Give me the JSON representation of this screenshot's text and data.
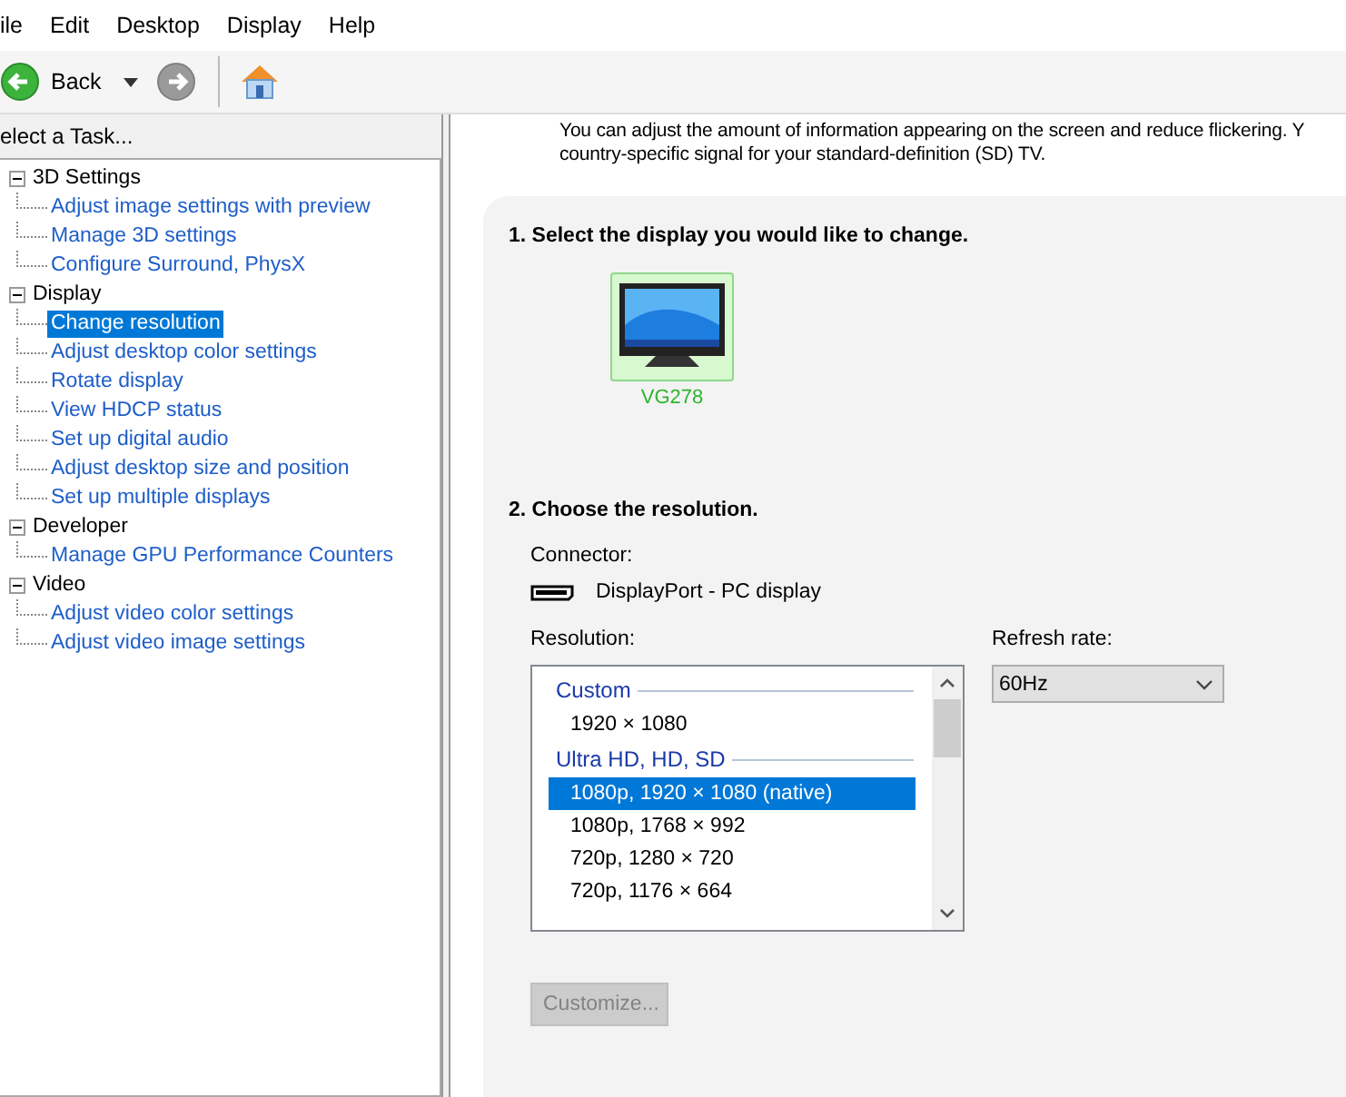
{
  "menu_bar": [
    "ile",
    "Edit",
    "Desktop",
    "Display",
    "Help"
  ],
  "toolbar": {
    "back": "Back"
  },
  "task_pane": {
    "title": "elect a Task...",
    "tree": [
      {
        "label": "3D Settings",
        "expanded": true,
        "children": [
          {
            "label": "Adjust image settings with preview",
            "selected": false
          },
          {
            "label": "Manage 3D settings",
            "selected": false
          },
          {
            "label": "Configure Surround, PhysX",
            "selected": false
          }
        ]
      },
      {
        "label": "Display",
        "expanded": true,
        "children": [
          {
            "label": "Change resolution",
            "selected": true
          },
          {
            "label": "Adjust desktop color settings",
            "selected": false
          },
          {
            "label": "Rotate display",
            "selected": false
          },
          {
            "label": "View HDCP status",
            "selected": false
          },
          {
            "label": "Set up digital audio",
            "selected": false
          },
          {
            "label": "Adjust desktop size and position",
            "selected": false
          },
          {
            "label": "Set up multiple displays",
            "selected": false
          }
        ]
      },
      {
        "label": "Developer",
        "expanded": true,
        "children": [
          {
            "label": "Manage GPU Performance Counters",
            "selected": false
          }
        ]
      },
      {
        "label": "Video",
        "expanded": true,
        "children": [
          {
            "label": "Adjust video color settings",
            "selected": false
          },
          {
            "label": "Adjust video image settings",
            "selected": false
          }
        ]
      }
    ]
  },
  "content": {
    "description": [
      "You can adjust the amount of information appearing on the screen and reduce flickering. Y",
      "country-specific signal for your standard-definition (SD) TV."
    ],
    "step1": "1. Select the display you would like to change.",
    "displays": [
      {
        "name": "VG278",
        "selected": true
      }
    ],
    "step2": "2. Choose the resolution.",
    "connector_label": "Connector:",
    "connector": "DisplayPort - PC display",
    "resolution_label": "Resolution:",
    "resolutions": [
      {
        "kind": "header",
        "label": "Custom"
      },
      {
        "kind": "item",
        "label": "1920 × 1080",
        "selected": false
      },
      {
        "kind": "header",
        "label": "Ultra HD, HD, SD"
      },
      {
        "kind": "item",
        "label": "1080p, 1920 × 1080 (native)",
        "selected": true
      },
      {
        "kind": "item",
        "label": "1080p, 1768 × 992",
        "selected": false
      },
      {
        "kind": "item",
        "label": "720p, 1280 × 720",
        "selected": false
      },
      {
        "kind": "item",
        "label": "720p, 1176 × 664",
        "selected": false
      }
    ],
    "refresh_label": "Refresh rate:",
    "refresh_rate": "60Hz",
    "customize": {
      "label": "Customize...",
      "disabled": true
    }
  }
}
